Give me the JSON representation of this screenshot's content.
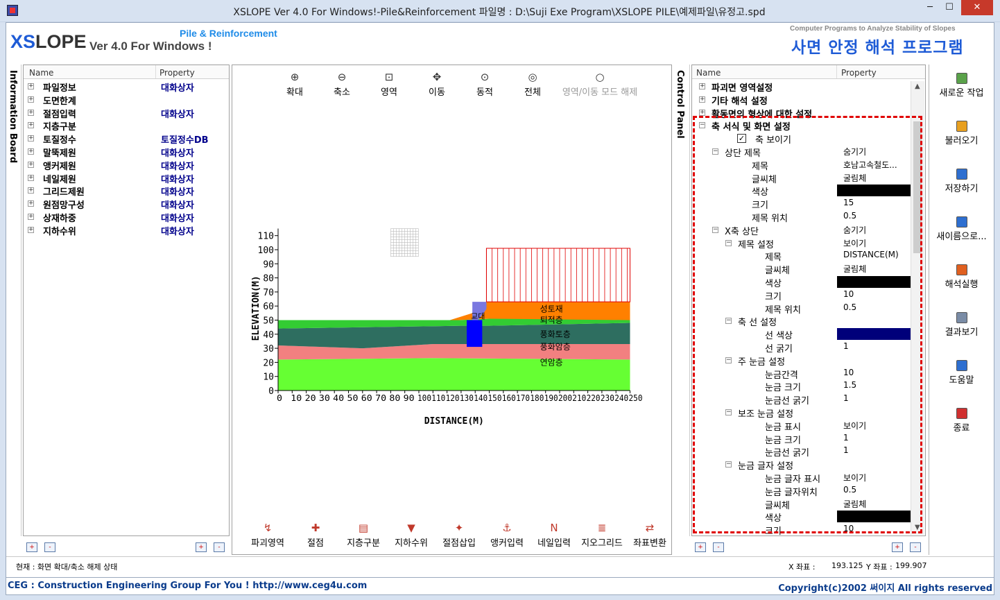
{
  "window": {
    "title": "XSLOPE Ver 4.0 For Windows!-Pile&Reinforcement  파일명 : D:\\Suji Exe Program\\XSLOPE PILE\\예제파일\\유정고.spd",
    "min": "─",
    "max": "☐",
    "close": "✕"
  },
  "header": {
    "logo_xs": "XS",
    "logo_lope": "LOPE",
    "version": "Ver 4.0 For Windows !",
    "subtitle": "Pile & Reinforcement",
    "tagline": "Computer Programs to Analyze Stability of Slopes",
    "korean_title": "사면 안정 해석 프로그램"
  },
  "left_board": {
    "side_label": "Information Board",
    "col_name": "Name",
    "col_property": "Property",
    "items": [
      {
        "name": "파일정보",
        "prop": "대화상자"
      },
      {
        "name": "도면한계",
        "prop": ""
      },
      {
        "name": "절점입력",
        "prop": "대화상자"
      },
      {
        "name": "지층구분",
        "prop": ""
      },
      {
        "name": "토질정수",
        "prop": "토질정수DB"
      },
      {
        "name": "말뚝제원",
        "prop": "대화상자"
      },
      {
        "name": "앵커제원",
        "prop": "대화상자"
      },
      {
        "name": "네일제원",
        "prop": "대화상자"
      },
      {
        "name": "그리드제원",
        "prop": "대화상자"
      },
      {
        "name": "원점망구성",
        "prop": "대화상자"
      },
      {
        "name": "상재하중",
        "prop": "대화상자"
      },
      {
        "name": "지하수위",
        "prop": "대화상자"
      }
    ]
  },
  "top_tools": [
    {
      "label": "확대",
      "icon": "zoom-in-icon",
      "glyph": "⊕"
    },
    {
      "label": "축소",
      "icon": "zoom-out-icon",
      "glyph": "⊖"
    },
    {
      "label": "영역",
      "icon": "zoom-area-icon",
      "glyph": "⊡"
    },
    {
      "label": "이동",
      "icon": "pan-icon",
      "glyph": "✥"
    },
    {
      "label": "동적",
      "icon": "dynamic-zoom-icon",
      "glyph": "⊙"
    },
    {
      "label": "전체",
      "icon": "zoom-all-icon",
      "glyph": "◎"
    },
    {
      "label": "영역/이동 모드 해제",
      "icon": "mode-off-icon",
      "glyph": "○"
    }
  ],
  "bottom_tools": [
    {
      "label": "파괴영역",
      "icon": "failure-zone-icon",
      "glyph": "↯"
    },
    {
      "label": "절점",
      "icon": "node-icon",
      "glyph": "✚"
    },
    {
      "label": "지층구분",
      "icon": "layer-icon",
      "glyph": "▤"
    },
    {
      "label": "지하수위",
      "icon": "water-level-icon",
      "glyph": "▼"
    },
    {
      "label": "절점삽입",
      "icon": "insert-node-icon",
      "glyph": "✦"
    },
    {
      "label": "앵커입력",
      "icon": "anchor-icon",
      "glyph": "⚓"
    },
    {
      "label": "네일입력",
      "icon": "nail-icon",
      "glyph": "N"
    },
    {
      "label": "지오그리드",
      "icon": "geogrid-icon",
      "glyph": "≣"
    },
    {
      "label": "좌표변환",
      "icon": "coord-transform-icon",
      "glyph": "⇄"
    }
  ],
  "chart": {
    "ylabel": "ELEVATION(M)",
    "xlabel": "DISTANCE(M)",
    "yticks": [
      "110",
      "100",
      "90",
      "80",
      "70",
      "60",
      "50",
      "40",
      "30",
      "20",
      "10",
      "0"
    ],
    "xticks": [
      "0",
      "10",
      "20",
      "30",
      "40",
      "50",
      "60",
      "70",
      "80",
      "90",
      "100",
      "110",
      "120",
      "130",
      "140",
      "150",
      "160",
      "170",
      "180",
      "190",
      "200",
      "210",
      "220",
      "230",
      "240",
      "250"
    ],
    "layer_labels": [
      "성토재",
      "퇴적층",
      "풍화토층",
      "풍화암층",
      "연암층",
      "교대"
    ],
    "colors": {
      "fill": "#ff8000",
      "sediment": "#33cc33",
      "weathered_soil": "#2e6e60",
      "weathered_rock": "#f28080",
      "soft_rock": "#66ff33",
      "abutment": "#0000ff",
      "surcharge": "#e00000"
    }
  },
  "control_panel": {
    "side_label": "Control Panel",
    "col_name": "Name",
    "col_property": "Property",
    "rows": [
      {
        "name": "파괴면 영역설정",
        "prop": ""
      },
      {
        "name": "기타 해석 설정",
        "prop": ""
      },
      {
        "name": "활동면의 형상에 대한 설정",
        "prop": ""
      },
      {
        "name": "축 서식 및 화면 설정",
        "prop": ""
      },
      {
        "name": "축 보이기",
        "prop": ""
      },
      {
        "name": "상단 제목",
        "prop": "숨기기"
      },
      {
        "name": "제목",
        "prop": "호남고속철도..."
      },
      {
        "name": "글씨체",
        "prop": "굴림체"
      },
      {
        "name": "색상",
        "prop": ""
      },
      {
        "name": "크기",
        "prop": "15"
      },
      {
        "name": "제목 위치",
        "prop": "0.5"
      },
      {
        "name": "X축 상단",
        "prop": "숨기기"
      },
      {
        "name": "제목 설정",
        "prop": "보이기"
      },
      {
        "name": "제목",
        "prop": "DISTANCE(M)"
      },
      {
        "name": "글씨체",
        "prop": "굴림체"
      },
      {
        "name": "색상",
        "prop": ""
      },
      {
        "name": "크기",
        "prop": "10"
      },
      {
        "name": "제목 위치",
        "prop": "0.5"
      },
      {
        "name": "축 선 설정",
        "prop": ""
      },
      {
        "name": "선 색상",
        "prop": ""
      },
      {
        "name": "선 굵기",
        "prop": "1"
      },
      {
        "name": "주 눈금 설정",
        "prop": ""
      },
      {
        "name": "눈금간격",
        "prop": "10"
      },
      {
        "name": "눈금 크기",
        "prop": "1.5"
      },
      {
        "name": "눈금선 굵기",
        "prop": "1"
      },
      {
        "name": "보조 눈금 설정",
        "prop": ""
      },
      {
        "name": "눈금 표시",
        "prop": "보이기"
      },
      {
        "name": "눈금 크기",
        "prop": "1"
      },
      {
        "name": "눈금선 굵기",
        "prop": "1"
      },
      {
        "name": "눈금 글자 설정",
        "prop": ""
      },
      {
        "name": "눈금 글자 표시",
        "prop": "보이기"
      },
      {
        "name": "눈금 글자위치",
        "prop": "0.5"
      },
      {
        "name": "글씨체",
        "prop": "굴림체"
      },
      {
        "name": "색상",
        "prop": ""
      },
      {
        "name": "크기",
        "prop": "10"
      }
    ]
  },
  "actions": [
    {
      "label": "새로운 작업",
      "icon": "new-file-icon"
    },
    {
      "label": "불러오기",
      "icon": "open-folder-icon"
    },
    {
      "label": "저장하기",
      "icon": "save-icon"
    },
    {
      "label": "새이름으로...",
      "icon": "save-as-icon"
    },
    {
      "label": "해석실행",
      "icon": "run-analysis-icon"
    },
    {
      "label": "결과보기",
      "icon": "print-results-icon"
    },
    {
      "label": "도움말",
      "icon": "help-icon"
    },
    {
      "label": "종료",
      "icon": "exit-icon"
    }
  ],
  "status": {
    "mode": "현재 : 화면 확대/축소 해제 상태",
    "x_label": "X 좌표 :",
    "x_value": "193.125",
    "y_label": "Y 좌표 :",
    "y_value": "199.907"
  },
  "footer": {
    "left": "CEG : Construction Engineering Group For You ! http://www.ceg4u.com",
    "right": "Copyright(c)2002 써이지 All rights reserved"
  }
}
